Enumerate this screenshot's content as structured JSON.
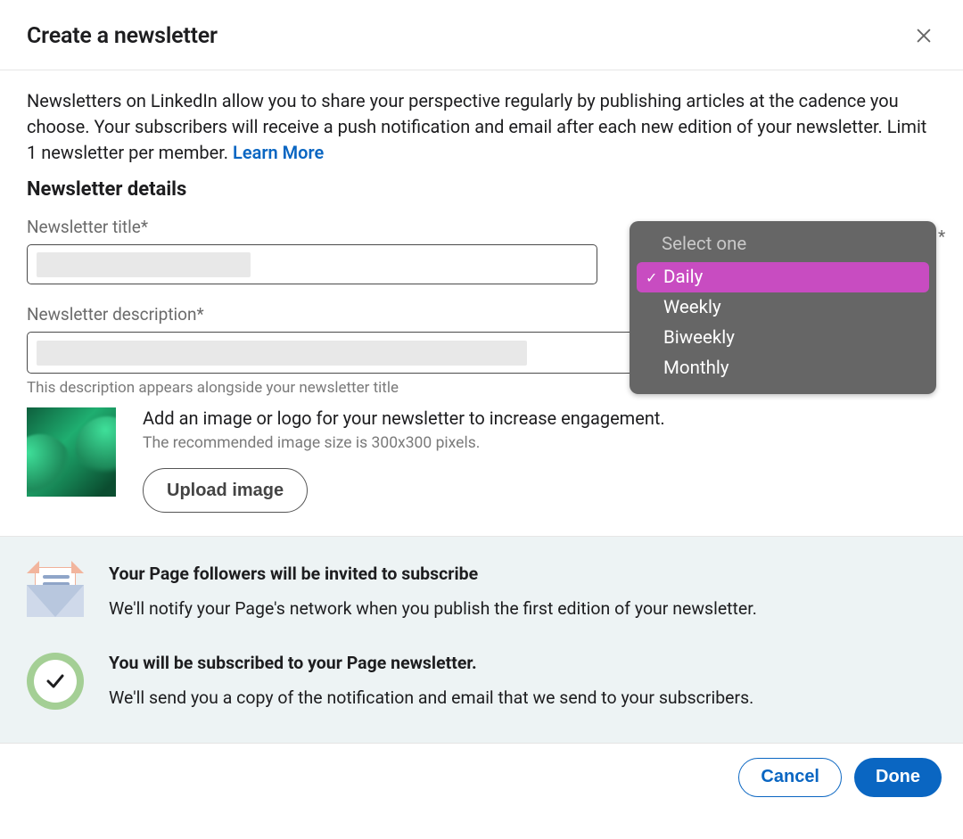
{
  "header": {
    "title": "Create a newsletter"
  },
  "intro": {
    "text": "Newsletters on LinkedIn allow you to share your perspective regularly by publishing articles at the cadence you choose. Your subscribers will receive a push notification and email after each new edition of your newsletter. Limit 1 newsletter per member. ",
    "learn_more": "Learn More"
  },
  "section_heading": "Newsletter details",
  "fields": {
    "title_label": "Newsletter title*",
    "description_label": "Newsletter description*",
    "description_helper": "This description appears alongside your newsletter title"
  },
  "upload": {
    "line1": "Add an image or logo for your newsletter to increase engagement.",
    "line2": "The recommended image size is 300x300 pixels.",
    "button": "Upload image"
  },
  "info": [
    {
      "heading": "Your Page followers will be invited to subscribe",
      "body": "We'll notify your Page's network when you publish the first edition of your newsletter."
    },
    {
      "heading": "You will be subscribed to your Page newsletter.",
      "body": "We'll send you a copy of the notification and email that we send to your subscribers."
    }
  ],
  "footer": {
    "cancel": "Cancel",
    "done": "Done"
  },
  "dropdown": {
    "placeholder": "Select one",
    "options": [
      "Daily",
      "Weekly",
      "Biweekly",
      "Monthly"
    ],
    "selected_index": 0,
    "required_mark": "*"
  }
}
